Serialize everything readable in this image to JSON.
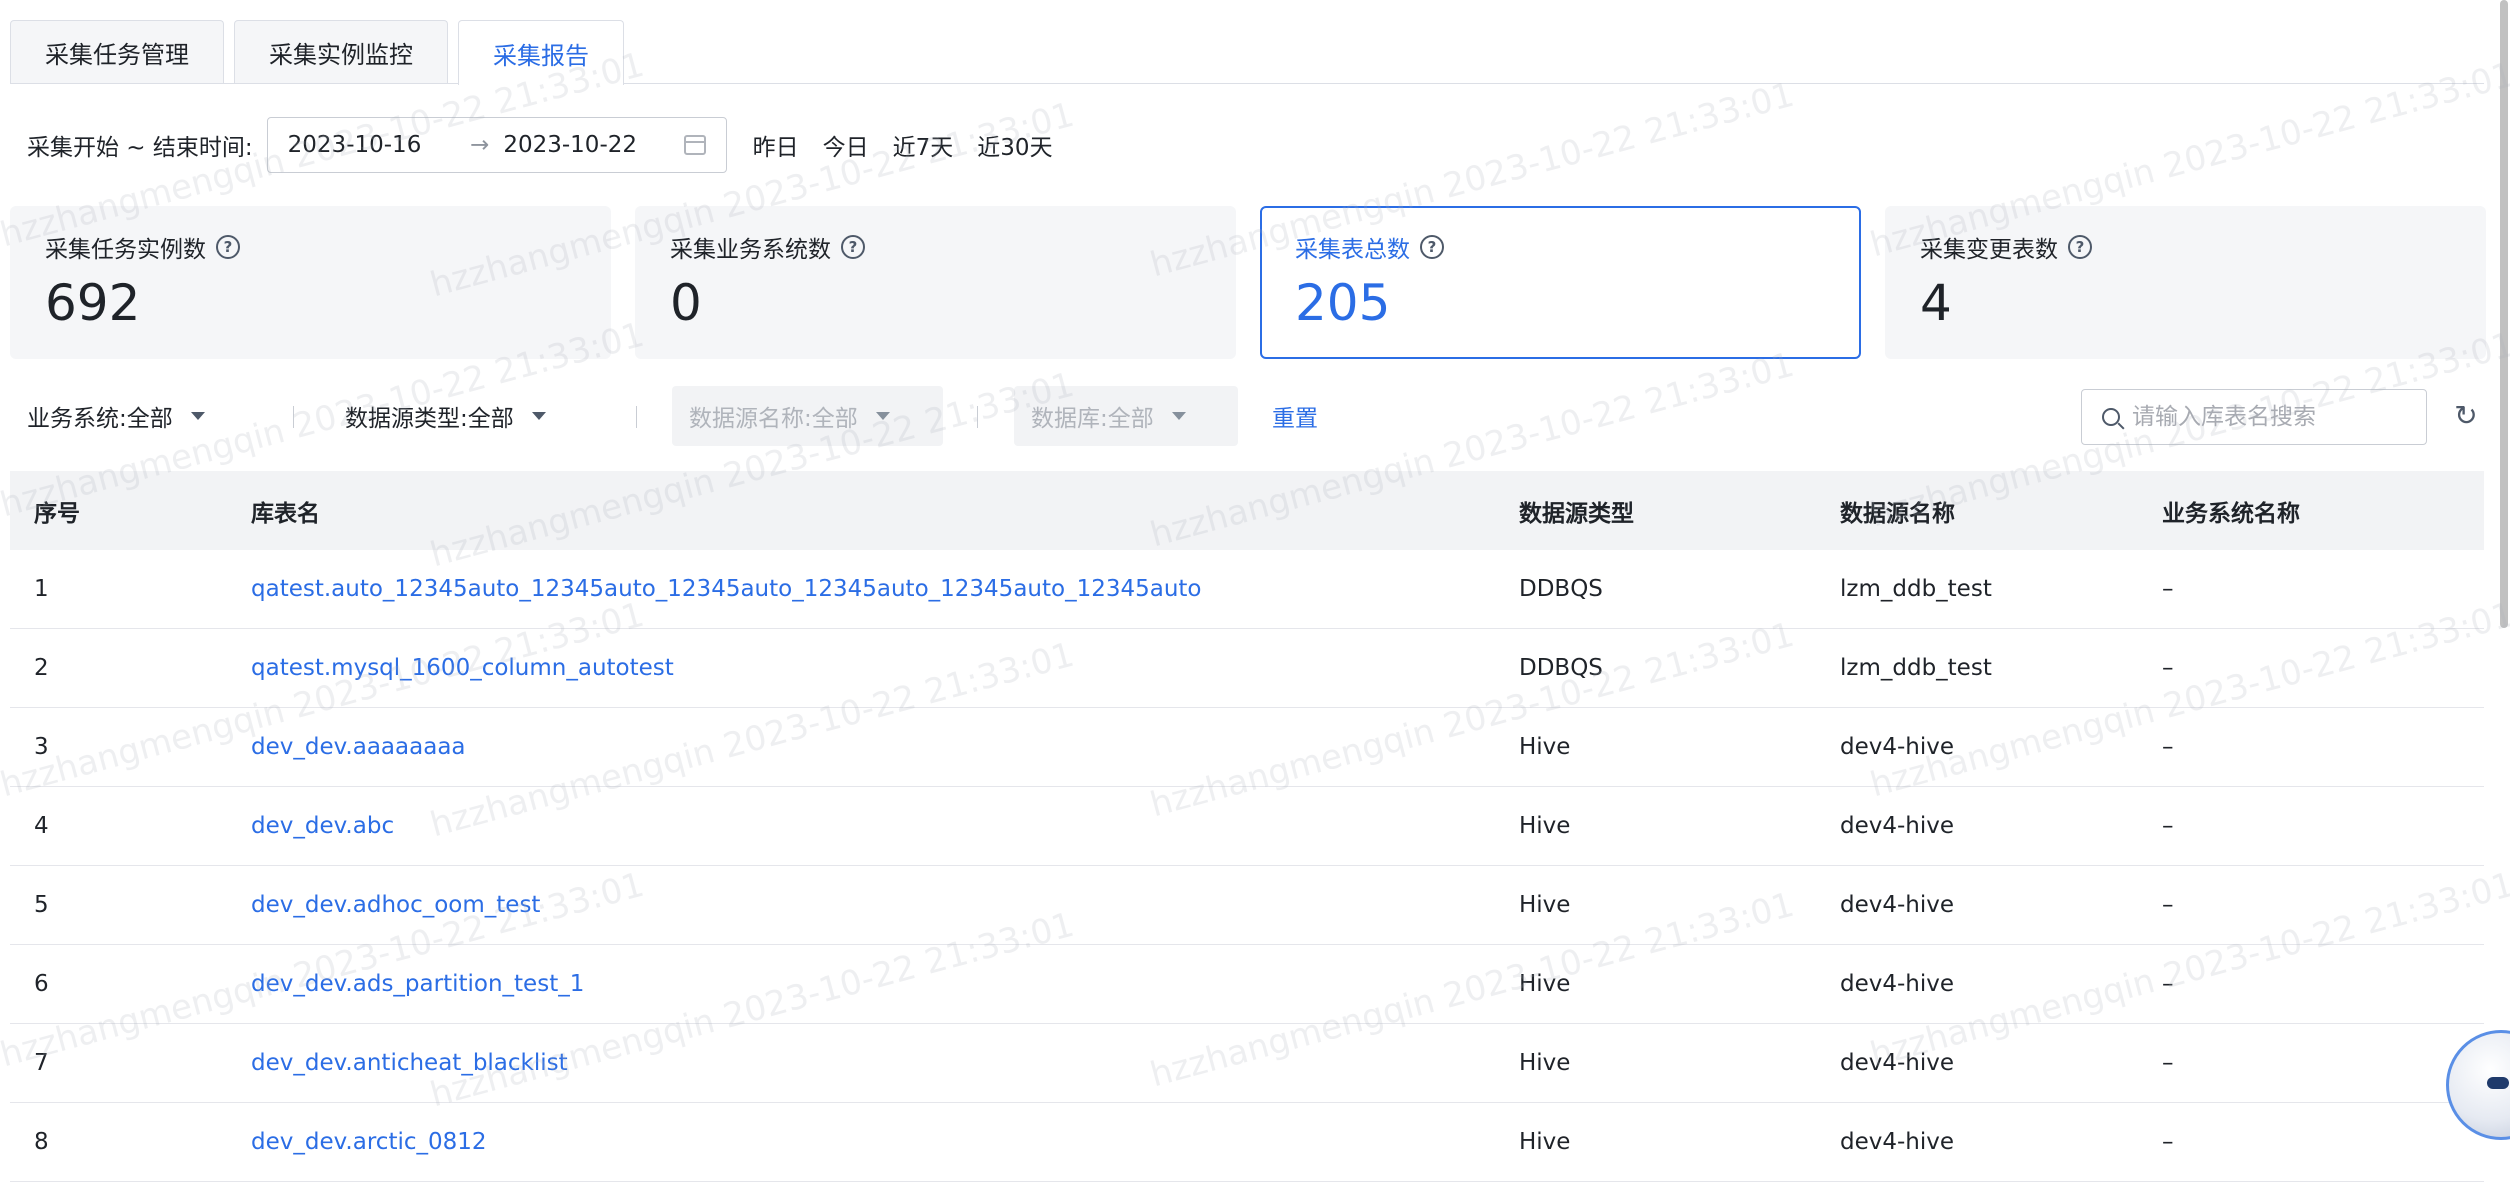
{
  "tabs": [
    {
      "label": "采集任务管理",
      "active": false
    },
    {
      "label": "采集实例监控",
      "active": false
    },
    {
      "label": "采集报告",
      "active": true
    }
  ],
  "date_filter": {
    "label": "采集开始 ~ 结束时间:",
    "start": "2023-10-16",
    "arrow": "→",
    "end": "2023-10-22",
    "quick": [
      "昨日",
      "今日",
      "近7天",
      "近30天"
    ]
  },
  "stats": [
    {
      "label": "采集任务实例数",
      "value": "692",
      "active": false
    },
    {
      "label": "采集业务系统数",
      "value": "0",
      "active": false
    },
    {
      "label": "采集表总数",
      "value": "205",
      "active": true
    },
    {
      "label": "采集变更表数",
      "value": "4",
      "active": false
    }
  ],
  "filters": {
    "business_system": "业务系统:全部",
    "datasource_type": "数据源类型:全部",
    "datasource_name": "数据源名称:全部",
    "database": "数据库:全部",
    "reset": "重置",
    "search_placeholder": "请输入库表名搜索"
  },
  "table": {
    "columns": [
      "序号",
      "库表名",
      "数据源类型",
      "数据源名称",
      "业务系统名称"
    ],
    "rows": [
      [
        "1",
        "qatest.auto_12345auto_12345auto_12345auto_12345auto_12345auto_12345auto",
        "DDBQS",
        "lzm_ddb_test",
        "–"
      ],
      [
        "2",
        "qatest.mysql_1600_column_autotest",
        "DDBQS",
        "lzm_ddb_test",
        "–"
      ],
      [
        "3",
        "dev_dev.aaaaaaaa",
        "Hive",
        "dev4-hive",
        "–"
      ],
      [
        "4",
        "dev_dev.abc",
        "Hive",
        "dev4-hive",
        "–"
      ],
      [
        "5",
        "dev_dev.adhoc_oom_test",
        "Hive",
        "dev4-hive",
        "–"
      ],
      [
        "6",
        "dev_dev.ads_partition_test_1",
        "Hive",
        "dev4-hive",
        "–"
      ],
      [
        "7",
        "dev_dev.anticheat_blacklist",
        "Hive",
        "dev4-hive",
        "–"
      ],
      [
        "8",
        "dev_dev.arctic_0812",
        "Hive",
        "dev4-hive",
        "–"
      ]
    ]
  },
  "watermark": "hzzhangmengqin 2023-10-22 21:33:01",
  "icons": {
    "help": "question-circle-icon",
    "calendar": "calendar-icon",
    "search": "search-icon",
    "refresh": "refresh-icon",
    "dropdown": "caret-down-icon"
  },
  "colors": {
    "accent": "#2b6de5",
    "text": "#1f2329",
    "card_bg": "#f5f6f8"
  }
}
